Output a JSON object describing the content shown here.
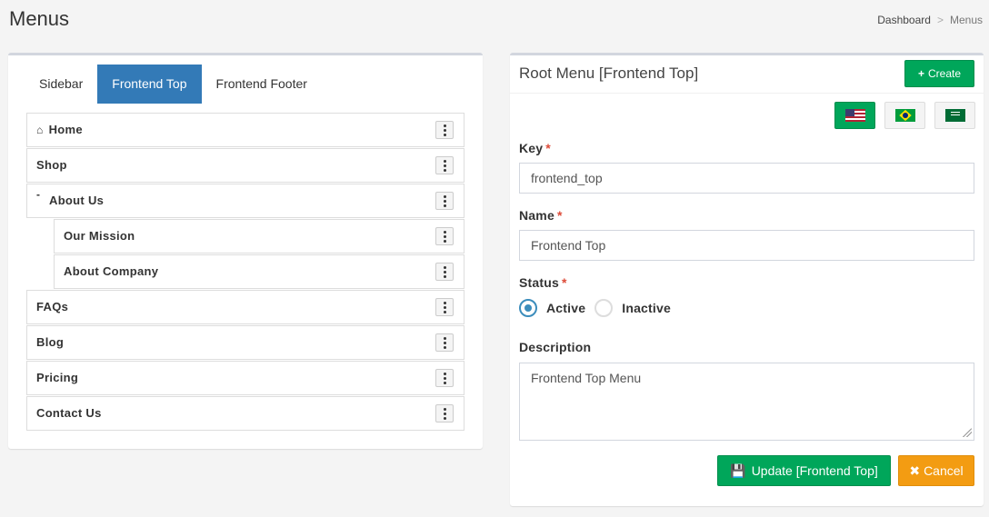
{
  "page": {
    "title": "Menus"
  },
  "breadcrumb": {
    "items": [
      "Dashboard",
      "Menus"
    ],
    "separator": ">"
  },
  "tabs": [
    {
      "label": "Sidebar",
      "active": false
    },
    {
      "label": "Frontend Top",
      "active": true
    },
    {
      "label": "Frontend Footer",
      "active": false
    }
  ],
  "menu_tree": [
    {
      "label": "Home",
      "icon": "home-icon"
    },
    {
      "label": "Shop"
    },
    {
      "label": "About Us",
      "collapse_mark": "-"
    },
    {
      "label": "Our Mission"
    },
    {
      "label": "About Company"
    },
    {
      "label": "FAQs"
    },
    {
      "label": "Blog"
    },
    {
      "label": "Pricing"
    },
    {
      "label": "Contact Us"
    }
  ],
  "form": {
    "title": "Root Menu [Frontend Top]",
    "create_label": "Create",
    "languages": [
      "en-US flag",
      "pt-BR flag",
      "ar-SA flag"
    ],
    "key_label": "Key",
    "key_value": "frontend_top",
    "name_label": "Name",
    "name_value": "Frontend Top",
    "status_label": "Status",
    "status_options": [
      "Active",
      "Inactive"
    ],
    "status_selected": "Active",
    "description_label": "Description",
    "description_value": "Frontend Top Menu",
    "required_mark": "*",
    "update_label": "Update [Frontend Top]",
    "cancel_label": "Cancel"
  },
  "colors": {
    "primary": "#337ab7",
    "success": "#00a65a",
    "warning": "#f39c12",
    "danger": "#dd4b39",
    "radio": "#3c8dbc"
  }
}
